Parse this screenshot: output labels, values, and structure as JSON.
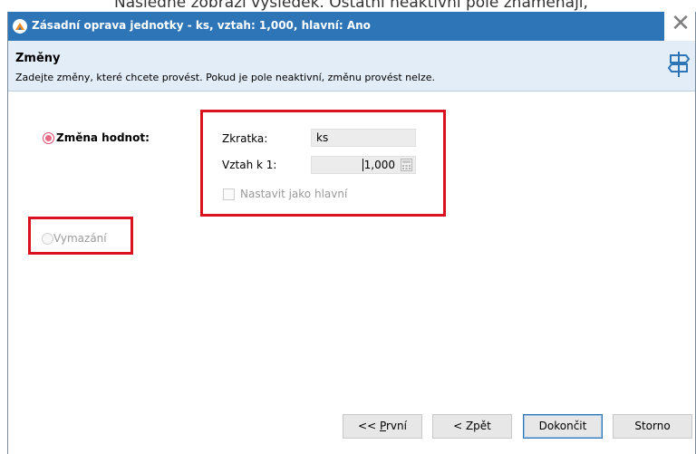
{
  "background_caption": "Následně zobrazí výsledek. Ostatní neaktivní pole znamenají,",
  "window": {
    "title": "Zásadní oprava jednotky - ks, vztah: 1,000, hlavní: Ano",
    "close_symbol": "✕"
  },
  "header": {
    "title": "Změny",
    "description": "Zadejte změny, které chcete provést. Pokud je pole neaktivní, změnu provést nelze.",
    "icon": "signpost-icon"
  },
  "options": {
    "change_values": {
      "label": "Změna hodnot:",
      "selected": true
    },
    "delete": {
      "label": "Vymazání",
      "selected": false,
      "enabled": false
    }
  },
  "fields": {
    "abbreviation": {
      "label": "Zkratka:",
      "value": "ks"
    },
    "ratio": {
      "label": "Vztah k 1:",
      "value": "1,000"
    },
    "set_main": {
      "label": "Nastavit jako hlavní",
      "checked": false,
      "enabled": false
    }
  },
  "buttons": {
    "first_prefix": "<< ",
    "first_mnemonic": "P",
    "first_rest": "rvní",
    "back": "< Zpět",
    "finish": "Dokončit",
    "cancel": "Storno"
  },
  "colors": {
    "titlebar": "#2e75b8",
    "header_bg": "#e3edf7",
    "highlight": "#d9121f",
    "radio_selected": "#e86a86"
  }
}
